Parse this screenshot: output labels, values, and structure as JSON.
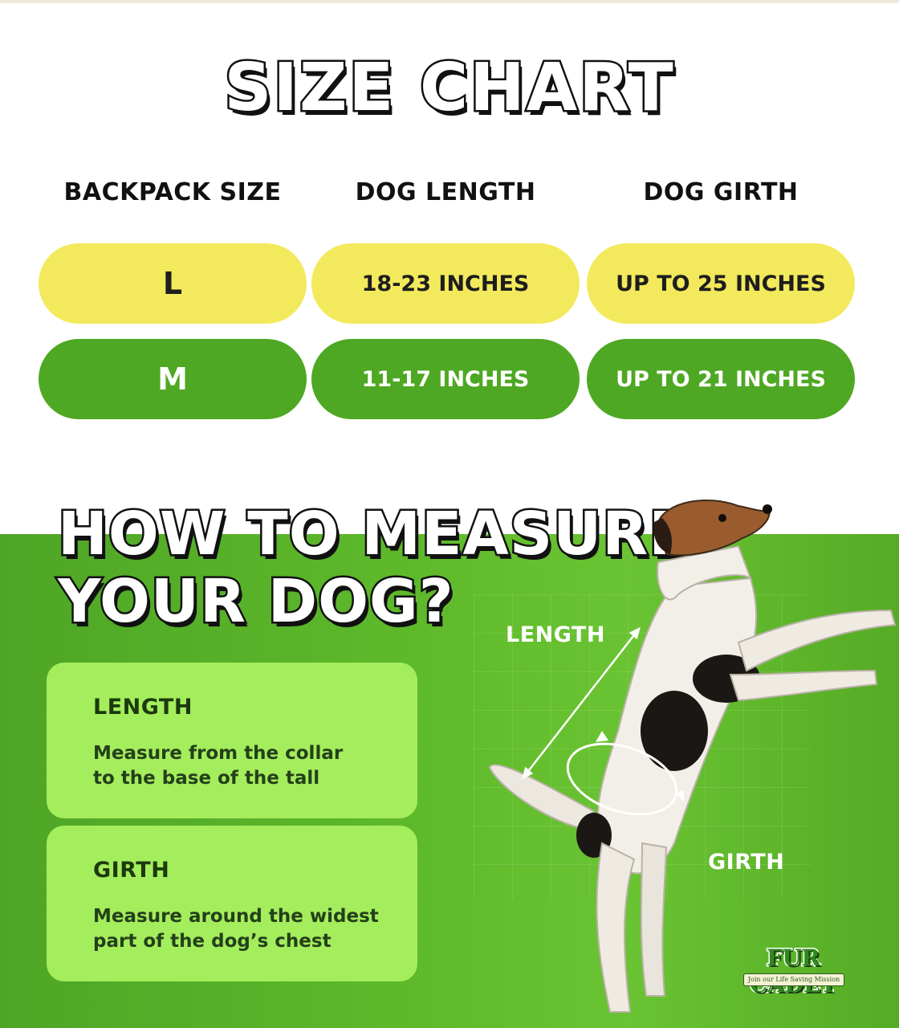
{
  "title": "SIZE CHART",
  "table": {
    "headers": [
      "BACKPACK SIZE",
      "DOG LENGTH",
      "DOG GIRTH"
    ],
    "rows": [
      {
        "size": "L",
        "length": "18-23 INCHES",
        "girth": "UP TO 25 INCHES",
        "color": "#f3e95c"
      },
      {
        "size": "M",
        "length": "11-17 INCHES",
        "girth": "UP TO 21 INCHES",
        "color": "#4ea823"
      }
    ]
  },
  "howto": {
    "line1": "HOW TO MEASURE",
    "line2": "YOUR DOG?"
  },
  "cards": [
    {
      "title": "LENGTH",
      "line1": "Measure from the collar",
      "line2": "to the base of the tall"
    },
    {
      "title": "GIRTH",
      "line1": "Measure around the widest",
      "line2": "part of the dog’s chest"
    }
  ],
  "dog_labels": {
    "length": "LENGTH",
    "girth": "GIRTH"
  },
  "brand": {
    "name": "FUR CADET",
    "tagline": "Join our Life Saving Mission"
  },
  "colors": {
    "yellow_pill": "#f3e95c",
    "green_pill": "#4ea823",
    "card": "#a4ed5c",
    "section_green": "#5eb92a"
  }
}
